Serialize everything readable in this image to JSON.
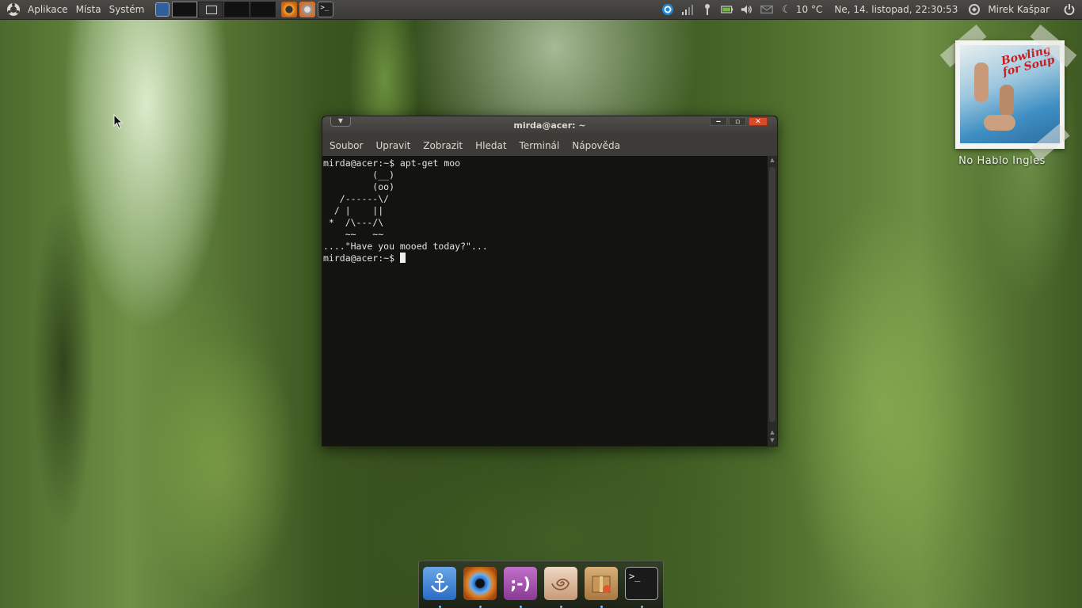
{
  "top_panel": {
    "menus": [
      "Aplikace",
      "Místa",
      "Systém"
    ],
    "weather": "10 °C",
    "datetime": "Ne, 14. listopad, 22:30:53",
    "user": "Mirek Kašpar"
  },
  "terminal": {
    "title": "mirda@acer: ~",
    "menu": [
      "Soubor",
      "Upravit",
      "Zobrazit",
      "Hledat",
      "Terminál",
      "Nápověda"
    ],
    "lines": [
      "mirda@acer:~$ apt-get moo",
      "         (__)",
      "         (oo)",
      "   /------\\/",
      "  / |    ||",
      " *  /\\---/\\",
      "    ~~   ~~",
      "....\"Have you mooed today?\"...",
      "mirda@acer:~$ "
    ]
  },
  "photo_widget": {
    "album_text": "Bowling for Soup",
    "caption": "No Hablo Ingles"
  },
  "dock": {
    "items": [
      "anchor-icon",
      "eye-icon",
      "chat-icon",
      "shell-icon",
      "package-icon",
      "terminal-icon"
    ]
  },
  "colors": {
    "panel": "#3c3b37",
    "accent": "#e0582a",
    "close_button": "#d94a2a"
  }
}
